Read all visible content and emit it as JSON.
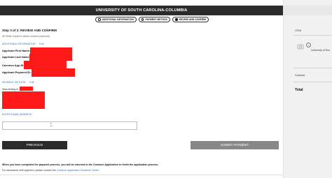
{
  "header": {
    "title": "UNIVERSITY OF SOUTH CAROLINA-COLUMBIA"
  },
  "steps": [
    {
      "label": "ADDITIONAL INFORMATION",
      "active": false
    },
    {
      "label": "PAYMENT METHOD",
      "active": false
    },
    {
      "label": "REVIEW AND CONFIRM",
      "active": true
    }
  ],
  "page": {
    "heading": "Step 3 of 3: REVIEW AND CONFIRM",
    "note": "All fields required unless marked (optional)"
  },
  "additional_info": {
    "section_label": "ADDITIONAL INFORMATION",
    "edit_label": "Edit",
    "fields": [
      {
        "label": "Applicant First Name:"
      },
      {
        "label": "Applicant Last Name:"
      },
      {
        "label": "Common App ID:"
      },
      {
        "label": "Applicant Payment ID:"
      }
    ]
  },
  "payment_method": {
    "section_label": "PAYMENT METHOD",
    "edit_label": "Edit",
    "card_text": "Visa ending in"
  },
  "email": {
    "label": "ENTER EMAIL ADDRESS",
    "value": "",
    "placeholder": ""
  },
  "buttons": {
    "previous": "PREVIOUS",
    "submit": "SUBMIT PAYMENT"
  },
  "footer": {
    "line1": "When you have completed the payment process, you will be returned to the Common Application to finish the application process.",
    "line2_prefix": "For assistance with payment, please contact the",
    "line2_link": "Common Application Solutions Center."
  },
  "sidebar": {
    "item_header": "ITEM",
    "item_name": "University of Sou",
    "info_icon": "info-icon",
    "subtotal_label": "Subtotal",
    "total_label": "Total"
  },
  "colors": {
    "header_bg": "#2b2b2b",
    "link": "#3a6fb8",
    "redaction": "#ff1a1a",
    "submit_bg": "#888888",
    "sidebar_bg": "#f1f1f1"
  }
}
